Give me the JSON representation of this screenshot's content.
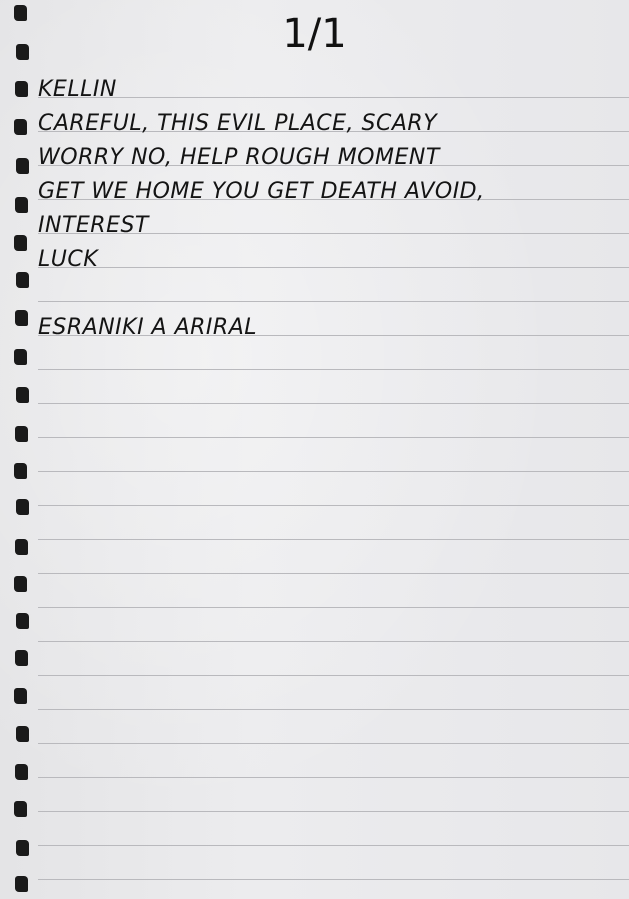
{
  "page_number": "1/1",
  "note_lines": [
    "KELLIN",
    "CAREFUL, THIS EVIL PLACE, SCARY",
    "WORRY NO, HELP ROUGH MOMENT",
    "GET WE HOME YOU GET DEATH AVOID,",
    "INTEREST",
    "LUCK",
    "",
    "ESRANIKI A ARIRAL"
  ],
  "colors": {
    "paper": "#ececee",
    "ruling": "#b9b9bd",
    "ink": "#141414",
    "binding_hole": "#1a1a1a"
  }
}
